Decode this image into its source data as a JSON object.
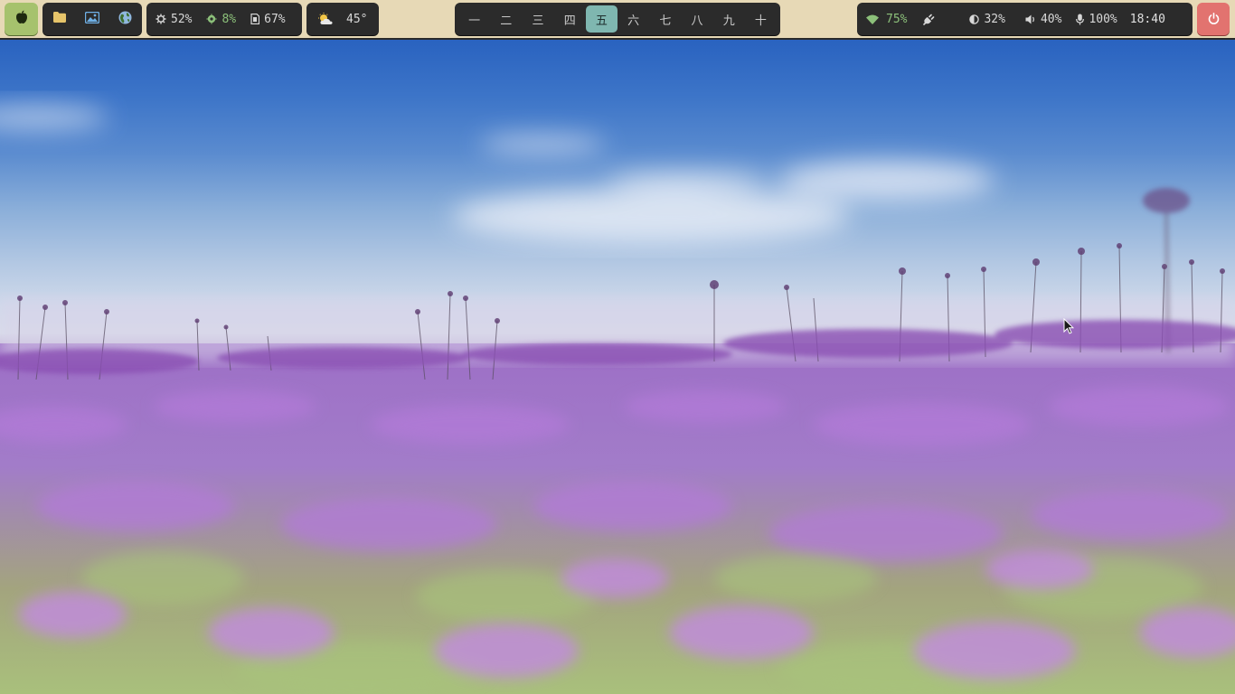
{
  "bar": {
    "launcher": {
      "icon": "apple-icon"
    },
    "apps": [
      {
        "icon": "folder-icon"
      },
      {
        "icon": "image-icon"
      },
      {
        "icon": "globe-icon"
      }
    ],
    "system": {
      "cpu": {
        "icon": "cpu-icon",
        "value": "52%"
      },
      "gpu": {
        "icon": "chip-icon",
        "value": "8%"
      },
      "memory": {
        "icon": "memory-icon",
        "value": "67%"
      }
    },
    "weather": {
      "icon": "partly-cloudy-icon",
      "value": "45°"
    },
    "workspaces": [
      {
        "label": "一",
        "active": false
      },
      {
        "label": "二",
        "active": false
      },
      {
        "label": "三",
        "active": false
      },
      {
        "label": "四",
        "active": false
      },
      {
        "label": "五",
        "active": true
      },
      {
        "label": "六",
        "active": false
      },
      {
        "label": "七",
        "active": false
      },
      {
        "label": "八",
        "active": false
      },
      {
        "label": "九",
        "active": false
      },
      {
        "label": "十",
        "active": false
      }
    ],
    "status": {
      "wifi": {
        "icon": "wifi-icon",
        "value": "75%"
      },
      "power": {
        "icon": "plug-icon"
      },
      "brightness": {
        "icon": "brightness-icon",
        "value": "32%"
      },
      "volume": {
        "icon": "volume-icon",
        "value": "40%"
      },
      "microphone": {
        "icon": "microphone-icon",
        "value": "100%"
      },
      "clock": "18:40"
    },
    "power_button": {
      "icon": "power-icon"
    }
  },
  "colors": {
    "bar_background": "#e7d9b6",
    "pill_background": "#2b2b2b",
    "launcher_green": "#a6c26d",
    "power_red": "#e2736f",
    "workspace_active": "#7fb7b0",
    "accent_green": "#8cc07a"
  }
}
